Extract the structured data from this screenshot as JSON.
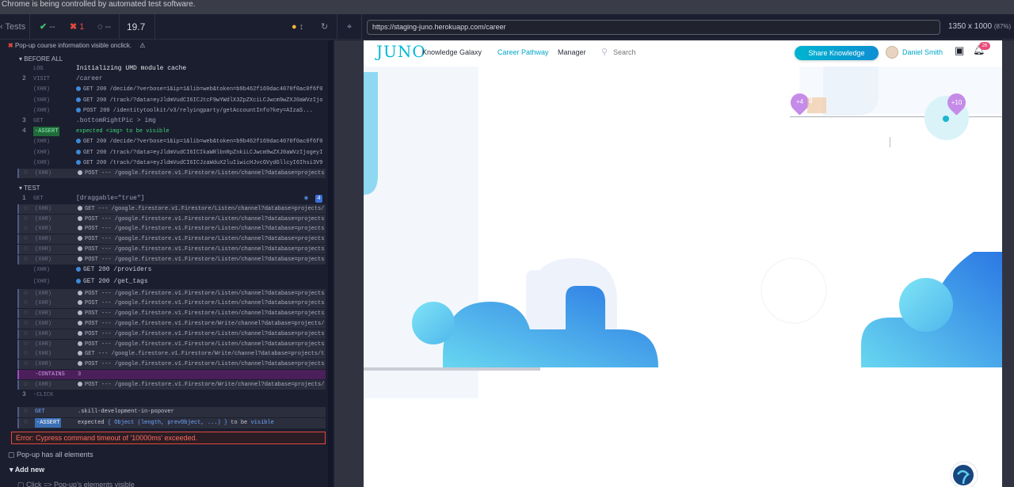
{
  "banner": "Chrome is being controlled by automated test software.",
  "topbar": {
    "tests_label": "Tests",
    "passed": "--",
    "failed": "1",
    "pending": "--",
    "duration": "19.7",
    "url": "https://staging-juno.herokuapp.com/career",
    "viewport": "1350 x 1000",
    "zoom": "(87%)"
  },
  "reporter": {
    "suite_title": "Pop-up course information visible onclick.",
    "before_all": "BEFORE ALL",
    "test_label": "TEST",
    "error": "Error: Cypress command timeout of '10000ms' exceeded.",
    "next_test": "Pop-up has all elements",
    "add_new": "Add new",
    "last_item": "Click => Pop-up's elements visible",
    "commands": [
      {
        "num": "",
        "kw": "LOG",
        "msg": "Initializing UMD module cache",
        "style": "plain"
      },
      {
        "num": "2",
        "kw": "VISIT",
        "msg": "/career",
        "style": "plain"
      },
      {
        "num": "",
        "kw": "(XHR)",
        "msg": "GET 200 /decide/?verbose=1&ip=1&lib=web&token=b9b462f169dac4070f0ac0f6f07...",
        "style": "plain",
        "dot": "blue"
      },
      {
        "num": "",
        "kw": "(XHR)",
        "msg": "GET 200 /track/?data=eyJldmVudCI6ICJtcF9wYWdlX3ZpZXciLCJwcm9wZXJ0aWVzIjogeyIkb...",
        "style": "plain",
        "dot": "blue"
      },
      {
        "num": "",
        "kw": "(XHR)",
        "msg": "POST 200 /identitytoolkit/v3/relyingparty/getAccountInfo?key=AIzaS...",
        "style": "plain",
        "dot": "blue"
      },
      {
        "num": "3",
        "kw": "GET",
        "msg": ".bottomRightPic > img",
        "style": "plain"
      },
      {
        "num": "4",
        "kw": "-ASSERT",
        "msg": "expected <img> to be visible",
        "style": "assert"
      },
      {
        "num": "",
        "kw": "(XHR)",
        "msg": "GET 200 /decide/?verbose=1&ip=1&lib=web&token=b9b462f169dac4070f0ac0f6f07...",
        "style": "plain",
        "dot": "blue"
      },
      {
        "num": "",
        "kw": "(XHR)",
        "msg": "GET 200 /track/?data=eyJldmVudCI6ICIkaWRlbnRpZnkiLCJwcm9wZXJ0aWVzIjogeyIkb3Mi...",
        "style": "plain",
        "dot": "blue"
      },
      {
        "num": "",
        "kw": "(XHR)",
        "msg": "GET 200 /track/?data=eyJldmVudCI6ICJzaWduX2luIiwicHJvcGVydGllcyI6Ihsi3V9yIjogi...",
        "style": "plain",
        "dot": "blue"
      },
      {
        "num": "",
        "kw": "(XHR)",
        "msg": "POST --- /google.firestore.v1.Firestore/Listen/channel?database=projects/test-c...",
        "style": "box",
        "dot": "grey"
      }
    ],
    "test_commands": [
      {
        "num": "1",
        "kw": "GET",
        "msg": "[draggable=\"true\"]",
        "style": "plain",
        "badge": "4"
      },
      {
        "num": "",
        "kw": "(XHR)",
        "msg": "GET --- /google.firestore.v1.Firestore/Listen/channel?database=projects/test-c...",
        "style": "box",
        "dot": "grey"
      },
      {
        "num": "",
        "kw": "(XHR)",
        "msg": "POST --- /google.firestore.v1.Firestore/Listen/channel?database=projects/test-c...",
        "style": "box",
        "dot": "grey"
      },
      {
        "num": "",
        "kw": "(XHR)",
        "msg": "POST --- /google.firestore.v1.Firestore/Listen/channel?database=projects/test-c...",
        "style": "box",
        "dot": "grey"
      },
      {
        "num": "",
        "kw": "(XHR)",
        "msg": "POST --- /google.firestore.v1.Firestore/Listen/channel?database=projects/test-c...",
        "style": "box",
        "dot": "grey"
      },
      {
        "num": "",
        "kw": "(XHR)",
        "msg": "POST --- /google.firestore.v1.Firestore/Listen/channel?database=projects/test-c...",
        "style": "box",
        "dot": "grey"
      },
      {
        "num": "",
        "kw": "(XHR)",
        "msg": "POST --- /google.firestore.v1.Firestore/Listen/channel?database=projects/test-c...",
        "style": "box",
        "dot": "grey"
      },
      {
        "num": "",
        "kw": "(XHR)",
        "msg": "GET 200 /providers",
        "style": "plain",
        "dot": "blue",
        "big": true
      },
      {
        "num": "",
        "kw": "(XHR)",
        "msg": "GET 200 /get_tags",
        "style": "plain",
        "dot": "blue",
        "big": true
      },
      {
        "num": "",
        "kw": "(XHR)",
        "msg": "POST --- /google.firestore.v1.Firestore/Listen/channel?database=projects/test-c...",
        "style": "box",
        "dot": "grey"
      },
      {
        "num": "",
        "kw": "(XHR)",
        "msg": "POST --- /google.firestore.v1.Firestore/Listen/channel?database=projects/test-c...",
        "style": "box",
        "dot": "grey"
      },
      {
        "num": "",
        "kw": "(XHR)",
        "msg": "POST --- /google.firestore.v1.Firestore/Listen/channel?database=projects/test-c...",
        "style": "box",
        "dot": "grey"
      },
      {
        "num": "",
        "kw": "(XHR)",
        "msg": "POST --- /google.firestore.v1.Firestore/Write/channel?database=projects/test-c...",
        "style": "box",
        "dot": "grey"
      },
      {
        "num": "",
        "kw": "(XHR)",
        "msg": "POST --- /google.firestore.v1.Firestore/Listen/channel?database=projects/test-c...",
        "style": "box",
        "dot": "grey"
      },
      {
        "num": "",
        "kw": "(XHR)",
        "msg": "POST --- /google.firestore.v1.Firestore/Listen/channel?database=projects/test-c...",
        "style": "box",
        "dot": "grey"
      },
      {
        "num": "",
        "kw": "(XHR)",
        "msg": "GET --- /google.firestore.v1.Firestore/Write/channel?database=projects/test-co...",
        "style": "box",
        "dot": "grey"
      },
      {
        "num": "",
        "kw": "(XHR)",
        "msg": "POST --- /google.firestore.v1.Firestore/Listen/channel?database=projects/test-c...",
        "style": "box",
        "dot": "grey"
      },
      {
        "num": "",
        "kw": "-CONTAINS",
        "msg": "3",
        "style": "contains"
      },
      {
        "num": "",
        "kw": "(XHR)",
        "msg": "POST --- /google.firestore.v1.Firestore/Write/channel?database=projects/test-c...",
        "style": "box",
        "dot": "grey"
      },
      {
        "num": "3",
        "kw": "-CLICK",
        "msg": "",
        "style": "plain"
      }
    ],
    "pending_get": {
      "kw": "GET",
      "msg": ".skill-development-in-popover"
    },
    "pending_assert": {
      "kw": "-ASSERT",
      "msg_pre": "expected",
      "msg_obj": "{ Object (length, prevObject, ...) }",
      "msg_mid": "to be",
      "msg_end": "visible"
    }
  },
  "app": {
    "logo": "JUNO",
    "nav": [
      "Knowledge Galaxy",
      "Career Pathway",
      "Manager"
    ],
    "search_placeholder": "Search",
    "share_button": "Share Knowledge",
    "user_name": "Daniel Smith",
    "notif_count": "26",
    "badge_left": "+4",
    "badge_left_partial": "3",
    "badge_right": "+10",
    "colors": {
      "accent": "#00a6c8",
      "badge": "#c58be8",
      "blue": "#2f7de6"
    }
  }
}
